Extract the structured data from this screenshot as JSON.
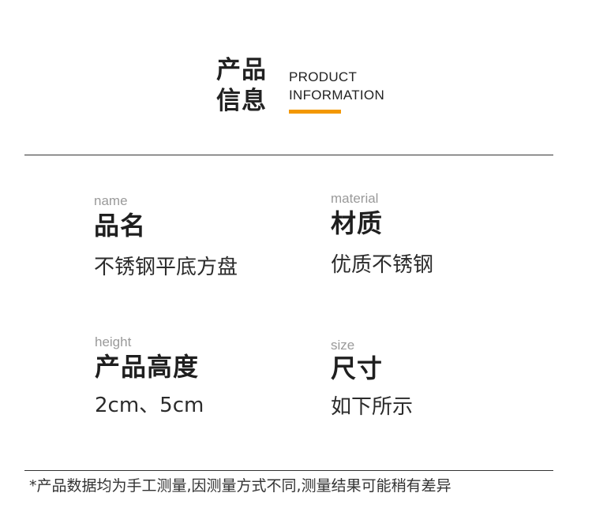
{
  "header": {
    "title_cn": "产品信息",
    "title_en_line1": "PRODUCT",
    "title_en_line2": "INFORMATION",
    "accent_color": "#f39800"
  },
  "specs": {
    "name": {
      "en": "name",
      "label": "品名",
      "value": "不锈钢平底方盘"
    },
    "material": {
      "en": "material",
      "label": "材质",
      "value": "优质不锈钢"
    },
    "height": {
      "en": "height",
      "label": "产品高度",
      "value": "2cm、5cm"
    },
    "size": {
      "en": "size",
      "label": "尺寸",
      "value": "如下所示"
    }
  },
  "footnote": "*产品数据均为手工测量,因测量方式不同,测量结果可能稍有差异"
}
